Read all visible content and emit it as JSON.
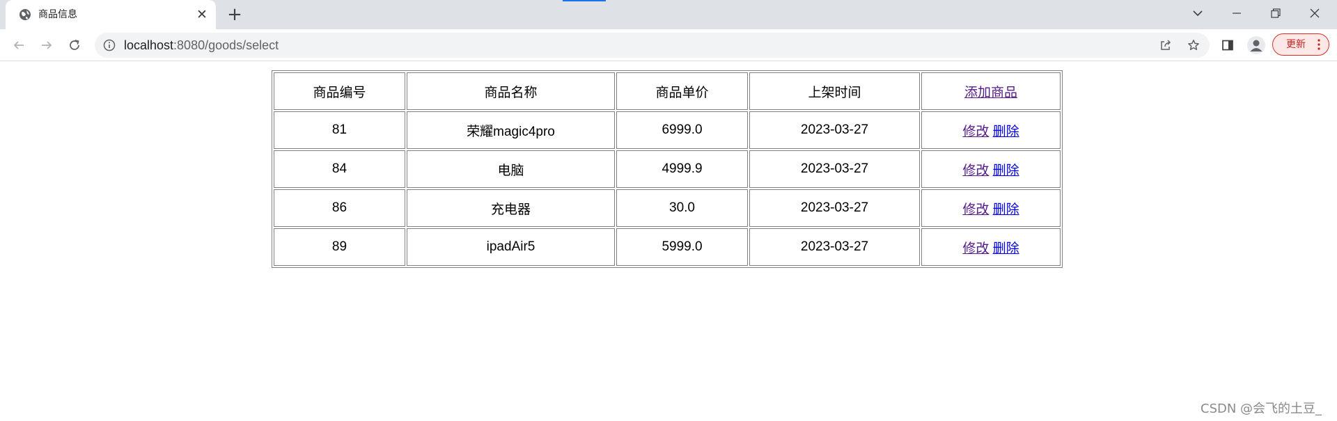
{
  "browser": {
    "tab": {
      "title": "商品信息",
      "close_glyph": "✕",
      "favicon": "globe-icon"
    },
    "new_tab_glyph": "+",
    "address": {
      "host": "localhost",
      "path": ":8080/goods/select"
    },
    "update_button_label": "更新",
    "accent_color": "#1a73e8",
    "update_color": "#d93025"
  },
  "table": {
    "headers": {
      "id": "商品编号",
      "name": "商品名称",
      "price": "商品单价",
      "date": "上架时间"
    },
    "add_link": "添加商品",
    "actions": {
      "edit": "修改",
      "delete": "删除"
    },
    "rows": [
      {
        "id": "81",
        "name": "荣耀magic4pro",
        "price": "6999.0",
        "date": "2023-03-27"
      },
      {
        "id": "84",
        "name": "电脑",
        "price": "4999.9",
        "date": "2023-03-27"
      },
      {
        "id": "86",
        "name": "充电器",
        "price": "30.0",
        "date": "2023-03-27"
      },
      {
        "id": "89",
        "name": "ipadAir5",
        "price": "5999.0",
        "date": "2023-03-27"
      }
    ]
  },
  "watermark": "CSDN @会飞的土豆_"
}
